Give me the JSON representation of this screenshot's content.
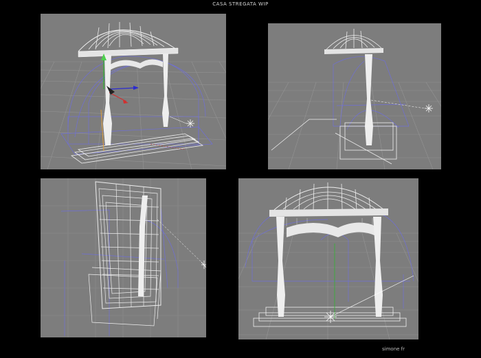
{
  "page": {
    "title": "CASA STREGATA  WIP",
    "credit": "simone  fr"
  },
  "viewports": [
    {
      "id": "perspective-view-1"
    },
    {
      "id": "perspective-view-2"
    },
    {
      "id": "top-view"
    },
    {
      "id": "front-view"
    }
  ],
  "colors": {
    "background": "#000000",
    "viewport_bg": "#7d7d7d",
    "grid": "#9a9a9a",
    "wire_blue": "#6f6fd8",
    "model": "#ececec",
    "axis_green": "#2fb52f",
    "axis_red": "#d23030",
    "axis_blue": "#2b2bd0"
  }
}
